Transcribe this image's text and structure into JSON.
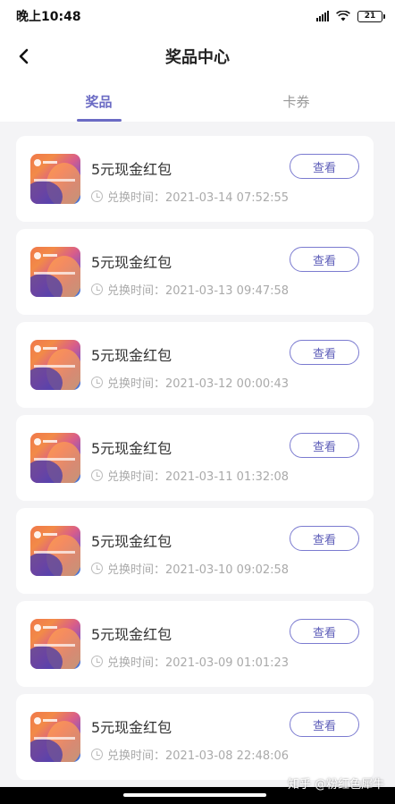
{
  "status_bar": {
    "time": "晚上10:48",
    "battery": "21"
  },
  "header": {
    "title": "奖品中心"
  },
  "tabs": [
    {
      "label": "奖品",
      "active": true
    },
    {
      "label": "卡券",
      "active": false
    }
  ],
  "prizes": [
    {
      "title": "5元现金红包",
      "time": "兑换时间：2021-03-14 07:52:55",
      "action": "查看"
    },
    {
      "title": "5元现金红包",
      "time": "兑换时间：2021-03-13 09:47:58",
      "action": "查看"
    },
    {
      "title": "5元现金红包",
      "time": "兑换时间：2021-03-12 00:00:43",
      "action": "查看"
    },
    {
      "title": "5元现金红包",
      "time": "兑换时间：2021-03-11 01:32:08",
      "action": "查看"
    },
    {
      "title": "5元现金红包",
      "time": "兑换时间：2021-03-10 09:02:58",
      "action": "查看"
    },
    {
      "title": "5元现金红包",
      "time": "兑换时间：2021-03-09 01:01:23",
      "action": "查看"
    },
    {
      "title": "5元现金红包",
      "time": "兑换时间：2021-03-08 22:48:06",
      "action": "查看"
    }
  ],
  "watermark": "知乎 @粉红色犀牛",
  "colors": {
    "accent": "#6b6bc4",
    "background": "#f4f4f6"
  }
}
